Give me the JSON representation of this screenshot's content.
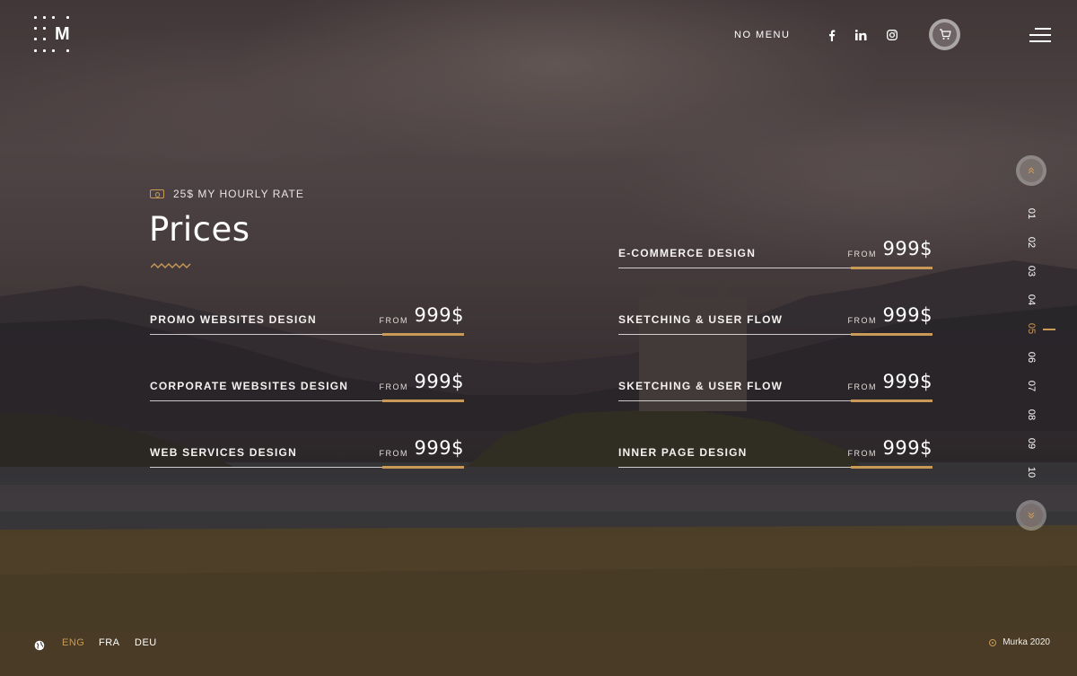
{
  "logo": {
    "letter": "M"
  },
  "header": {
    "menu_label": "NO MENU",
    "social": [
      "facebook-icon",
      "linkedin-icon",
      "instagram-icon"
    ],
    "cart_icon": "cart-icon",
    "menu_icon": "hamburger-icon"
  },
  "intro": {
    "rate_icon": "money-icon",
    "rate_text": "25$ MY HOURLY RATE",
    "title": "Prices"
  },
  "prices": {
    "from_label": "FROM",
    "left": [
      {
        "name": "PROMO WEBSITES DESIGN",
        "amount": "999$"
      },
      {
        "name": "CORPORATE WEBSITES DESIGN",
        "amount": "999$"
      },
      {
        "name": "WEB SERVICES DESIGN",
        "amount": "999$"
      }
    ],
    "right": [
      {
        "name": "E-COMMERCE DESIGN",
        "amount": "999$"
      },
      {
        "name": "SKETCHING & USER FLOW",
        "amount": "999$"
      },
      {
        "name": "SKETCHING & USER FLOW",
        "amount": "999$"
      },
      {
        "name": "INNER PAGE DESIGN",
        "amount": "999$"
      }
    ]
  },
  "pager": {
    "pages": [
      "01",
      "02",
      "03",
      "04",
      "05",
      "06",
      "07",
      "08",
      "09",
      "10"
    ],
    "active": "05",
    "up_icon": "chevron-up-icon",
    "down_icon": "chevron-down-icon"
  },
  "footer": {
    "globe_icon": "globe-icon",
    "languages": [
      "ENG",
      "FRA",
      "DEU"
    ],
    "active_language": "ENG",
    "copyright": "Murka 2020"
  },
  "colors": {
    "accent": "#c99a57",
    "text": "#ffffff"
  }
}
